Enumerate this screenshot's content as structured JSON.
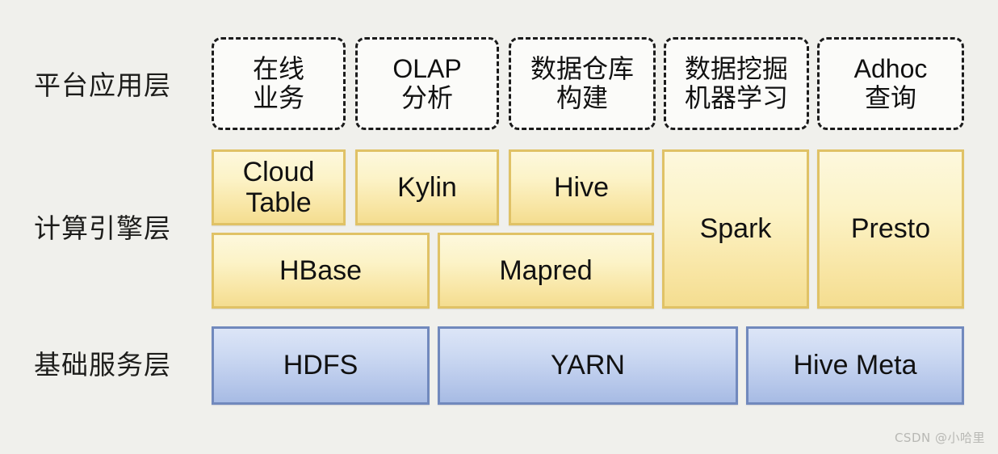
{
  "background_color": "#f0f0ec",
  "rows": [
    {
      "id": "application-layer",
      "label": "平台应用层",
      "style": "dashed-white"
    },
    {
      "id": "compute-engine-layer",
      "label": "计算引擎层",
      "style": "yellow"
    },
    {
      "id": "base-service-layer",
      "label": "基础服务层",
      "style": "blue"
    }
  ],
  "application_layer": {
    "accent_color": "#1b1b1b",
    "fill_color": "#fbfbf9",
    "boxes": [
      {
        "line1": "在线",
        "line2": "业务"
      },
      {
        "line1": "OLAP",
        "line2": "分析"
      },
      {
        "line1": "数据仓库",
        "line2": "构建"
      },
      {
        "line1": "数据挖掘",
        "line2": "机器学习"
      },
      {
        "line1": "Adhoc",
        "line2": "查询"
      }
    ]
  },
  "compute_engine_layer": {
    "accent_color": "#e0c266",
    "fill_top_color": "#fdf8dd",
    "fill_bottom_color": "#f4dd90",
    "top_row": [
      {
        "line1": "Cloud",
        "line2": "Table"
      },
      {
        "line1": "Kylin",
        "line2": ""
      },
      {
        "line1": "Hive",
        "line2": ""
      }
    ],
    "bottom_row": [
      {
        "line1": "HBase",
        "line2": ""
      },
      {
        "line1": "Mapred",
        "line2": ""
      }
    ],
    "tall_boxes": [
      {
        "line1": "Spark",
        "line2": ""
      },
      {
        "line1": "Presto",
        "line2": ""
      }
    ]
  },
  "base_service_layer": {
    "accent_color": "#7189bd",
    "fill_top_color": "#dce5f7",
    "fill_bottom_color": "#a7bbe4",
    "boxes": [
      {
        "line1": "HDFS"
      },
      {
        "line1": "YARN"
      },
      {
        "line1": "Hive Meta"
      }
    ]
  },
  "watermark": {
    "text": "CSDN @小哈里"
  }
}
